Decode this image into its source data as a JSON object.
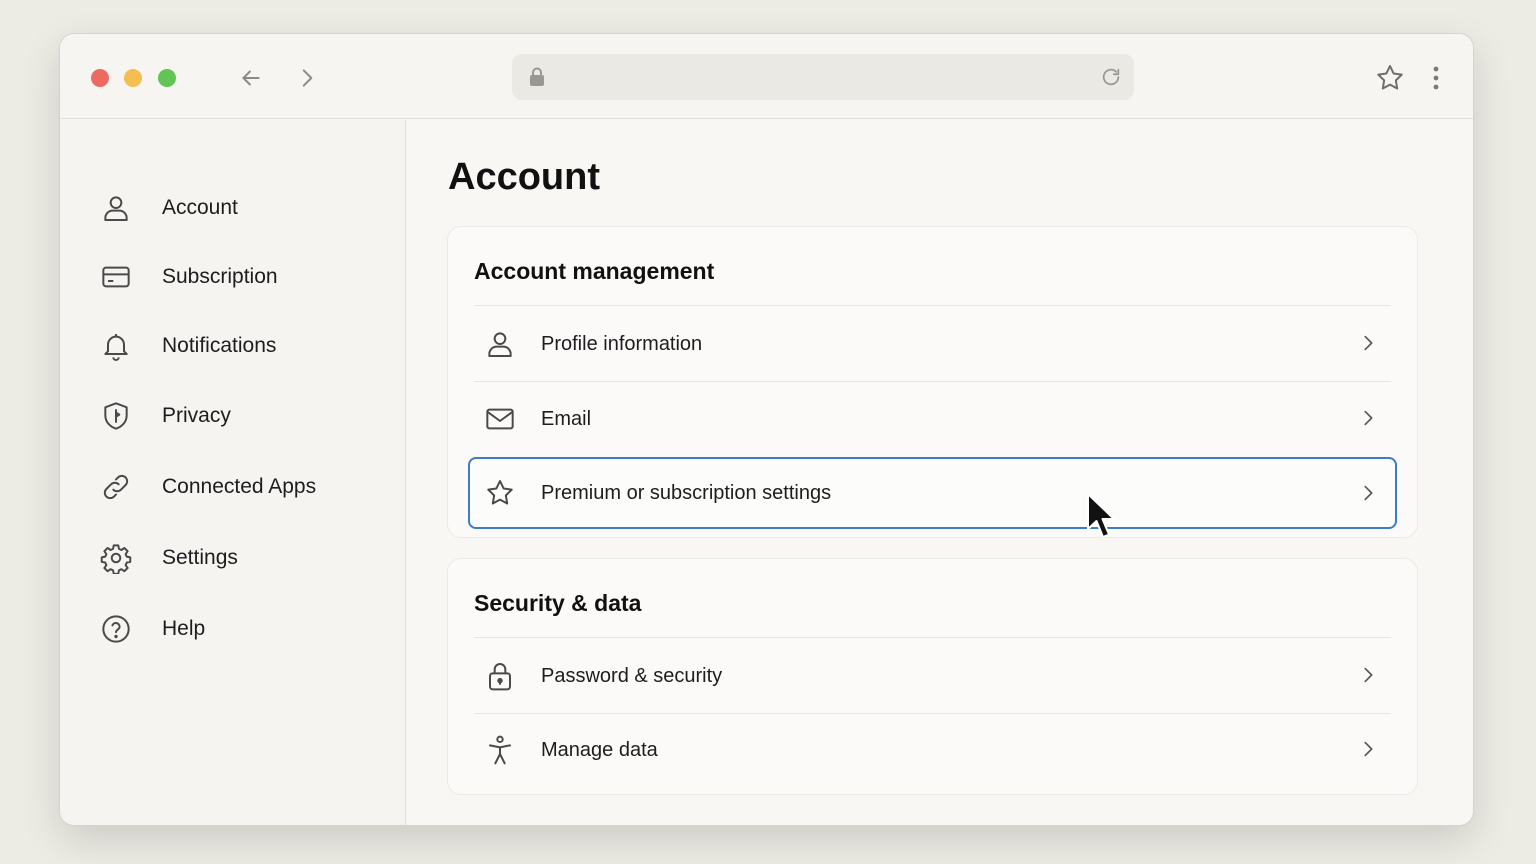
{
  "toolbar": {
    "address_text": "",
    "icons": [
      "back-arrow-icon",
      "forward-arrow-icon",
      "lock-icon",
      "reload-icon",
      "star-icon",
      "more-vertical-icon"
    ]
  },
  "sidebar": {
    "items": [
      {
        "label": "Account",
        "icon": "person-icon"
      },
      {
        "label": "Subscription",
        "icon": "card-icon"
      },
      {
        "label": "Notifications",
        "icon": "bell-icon"
      },
      {
        "label": "Privacy",
        "icon": "shield-icon"
      },
      {
        "label": "Connected Apps",
        "icon": "link-icon"
      },
      {
        "label": "Settings",
        "icon": "gear-icon"
      },
      {
        "label": "Help",
        "icon": "help-circle-icon"
      }
    ]
  },
  "main": {
    "title": "Account",
    "sections": [
      {
        "title": "Account management",
        "rows": [
          {
            "label": "Profile information",
            "icon": "person-icon"
          },
          {
            "label": "Email",
            "icon": "mail-icon"
          },
          {
            "label": "Premium or subscription settings",
            "icon": "star-icon",
            "selected": true
          }
        ]
      },
      {
        "title": "Security & data",
        "rows": [
          {
            "label": "Password & security",
            "icon": "padlock-icon"
          },
          {
            "label": "Manage data",
            "icon": "accessibility-icon"
          }
        ]
      }
    ]
  },
  "colors": {
    "selection_border": "#3d7cc9",
    "close": "#ec6a5f",
    "minimize": "#f4bf50",
    "zoom": "#61c454"
  }
}
